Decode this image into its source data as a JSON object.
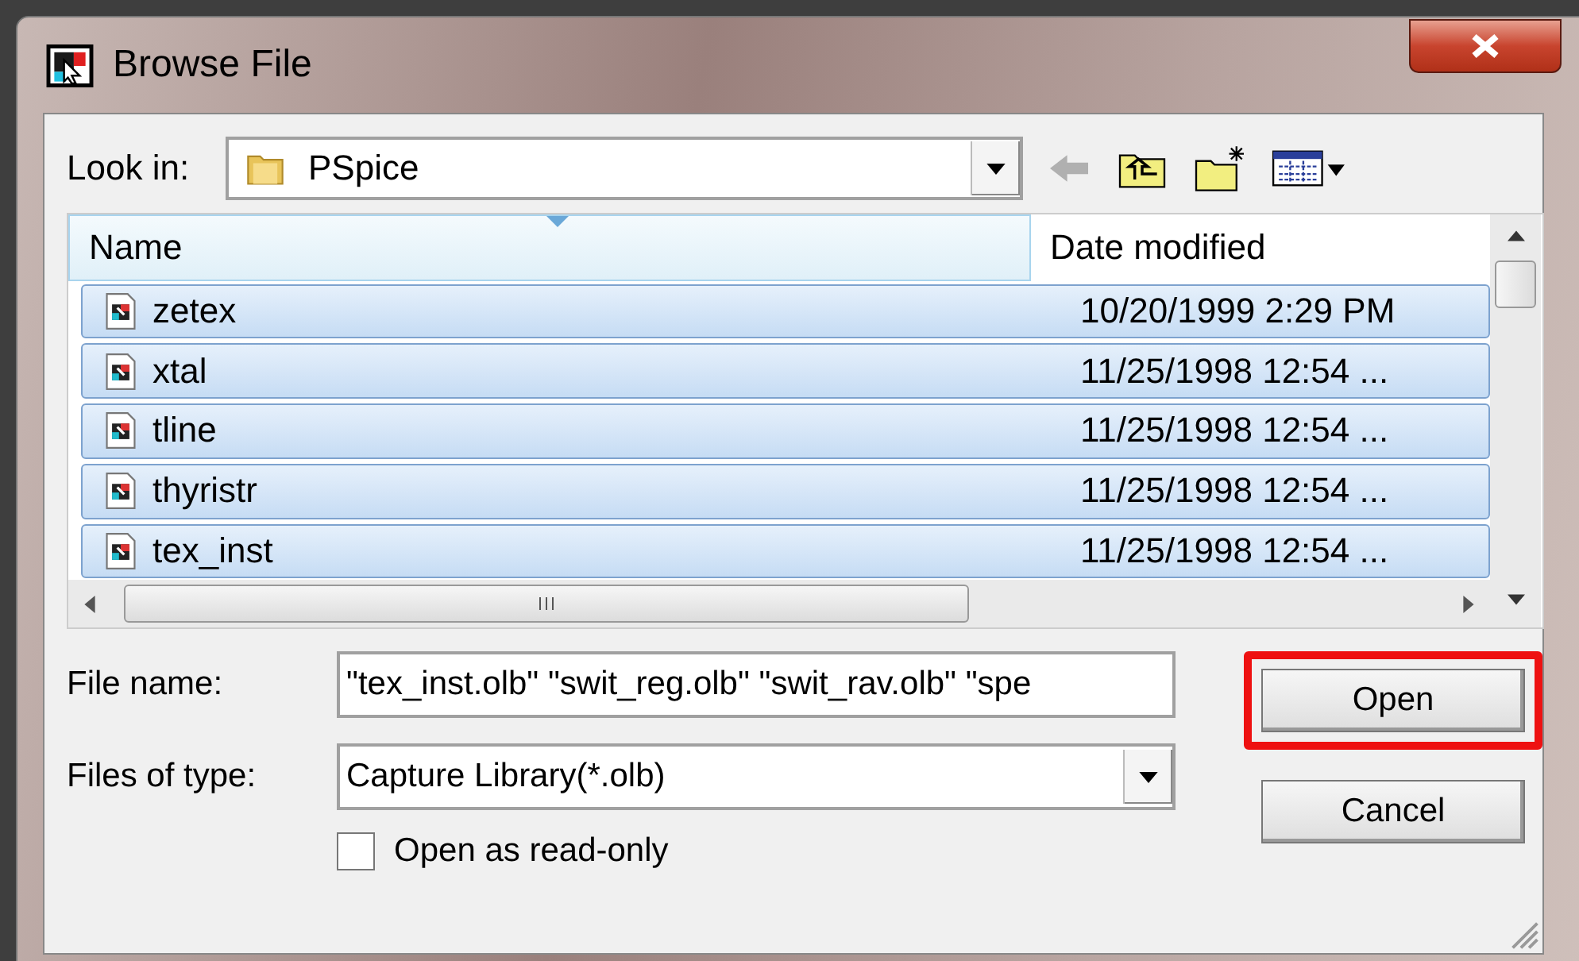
{
  "window": {
    "title": "Browse File"
  },
  "look_in": {
    "label": "Look in:",
    "value": "PSpice"
  },
  "columns": [
    "Name",
    "Date modified"
  ],
  "files": [
    {
      "name": "zetex",
      "date": "10/20/1999 2:29 PM",
      "selected": true
    },
    {
      "name": "xtal",
      "date": "11/25/1998 12:54 ...",
      "selected": true
    },
    {
      "name": "tline",
      "date": "11/25/1998 12:54 ...",
      "selected": true
    },
    {
      "name": "thyristr",
      "date": "11/25/1998 12:54 ...",
      "selected": true
    },
    {
      "name": "tex_inst",
      "date": "11/25/1998 12:54 ...",
      "selected": true
    }
  ],
  "file_name": {
    "label": "File name:",
    "value": "\"tex_inst.olb\" \"swit_reg.olb\" \"swit_rav.olb\" \"spe"
  },
  "file_type": {
    "label": "Files of type:",
    "value": "Capture Library(*.olb)"
  },
  "read_only": {
    "label": "Open as read-only",
    "checked": false
  },
  "buttons": [
    {
      "label": "Open",
      "highlighted": true
    },
    {
      "label": "Cancel",
      "highlighted": false
    }
  ]
}
